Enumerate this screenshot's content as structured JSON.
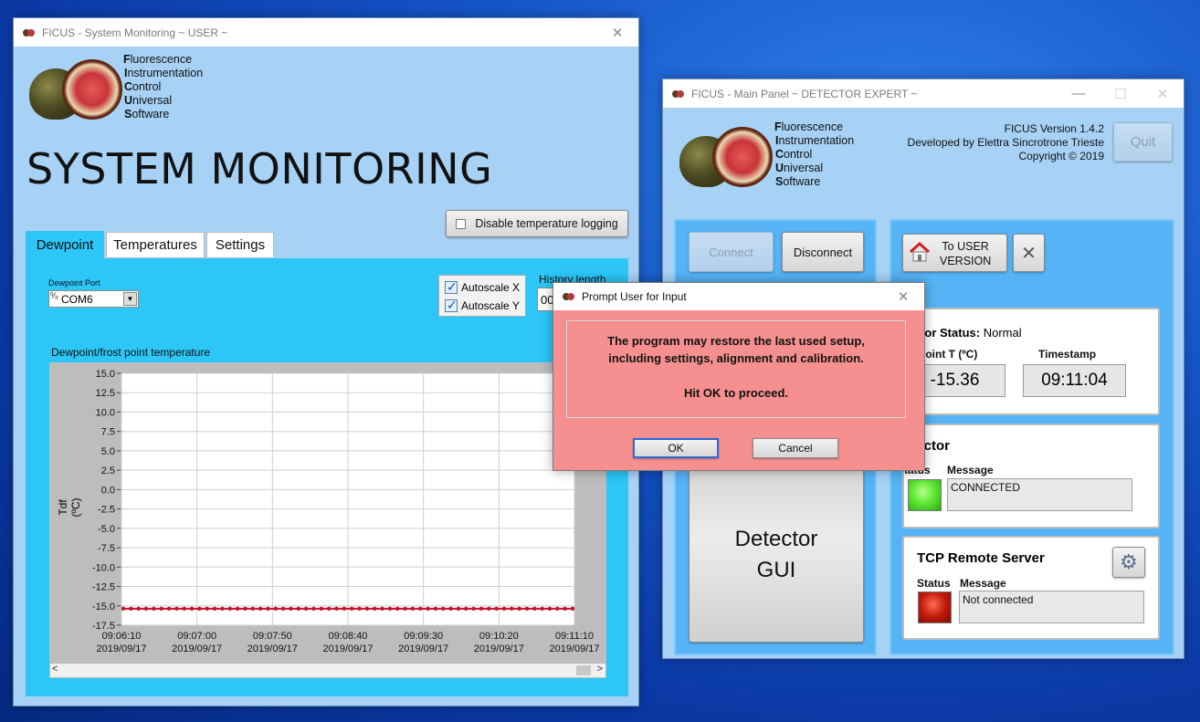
{
  "sysmon": {
    "title": "FICUS - System Monitoring ~ USER ~",
    "acronym": [
      {
        "first": "F",
        "rest": "luorescence"
      },
      {
        "first": "I",
        "rest": "nstrumentation"
      },
      {
        "first": "C",
        "rest": "ontrol"
      },
      {
        "first": "U",
        "rest": "niversal"
      },
      {
        "first": "S",
        "rest": "oftware"
      }
    ],
    "heading": "SYSTEM MONITORING",
    "disable_logging_label": "Disable temperature logging",
    "tabs": [
      "Dewpoint",
      "Temperatures",
      "Settings"
    ],
    "dewpoint_port_label": "Dewpoint Port",
    "dewpoint_port_value": "COM6",
    "autoscale_x": "Autoscale X",
    "autoscale_y": "Autoscale Y",
    "history_length_label": "History length",
    "history_length_value": "00",
    "chart_title": "Dewpoint/frost point temperature"
  },
  "chart_data": {
    "type": "line",
    "title": "Dewpoint/frost point temperature",
    "ylabel": "Tdf (ºC)",
    "xlabel": "",
    "ylim": [
      -17.5,
      15.0
    ],
    "yticks": [
      "15.0",
      "12.5",
      "10.0",
      "7.5",
      "5.0",
      "2.5",
      "0.0",
      "-2.5",
      "-5.0",
      "-7.5",
      "-10.0",
      "-12.5",
      "-15.0",
      "-17.5"
    ],
    "xticks": [
      {
        "time": "09:06:10",
        "date": "2019/09/17"
      },
      {
        "time": "09:07:00",
        "date": "2019/09/17"
      },
      {
        "time": "09:07:50",
        "date": "2019/09/17"
      },
      {
        "time": "09:08:40",
        "date": "2019/09/17"
      },
      {
        "time": "09:09:30",
        "date": "2019/09/17"
      },
      {
        "time": "09:10:20",
        "date": "2019/09/17"
      },
      {
        "time": "09:11:10",
        "date": "2019/09/17"
      }
    ],
    "xlim": [
      "09:06:10",
      "09:11:10"
    ],
    "grid": true,
    "series": [
      {
        "color": "#c8102e",
        "marker": "circle",
        "y_approx": -15.36,
        "points": 60
      }
    ]
  },
  "main": {
    "title": "FICUS - Main Panel ~ DETECTOR EXPERT ~",
    "version": "FICUS Version 1.4.2",
    "developer": "Developed by Elettra Sincrotrone Trieste",
    "copyright": "Copyright © 2019",
    "quit_label": "Quit",
    "connect_label": "Connect",
    "disconnect_label": "Disconnect",
    "to_user_label_1": "To USER",
    "to_user_label_2": "VERSION",
    "sensor_status_label": "ensor Status:",
    "sensor_status_value": "Normal",
    "dewpoint_label": "ewpoint T (ºC)",
    "dewpoint_value": "-15.36",
    "timestamp_label": "Timestamp",
    "timestamp_value": "09:11:04",
    "detector_gui_1": "Detector",
    "detector_gui_2": "GUI",
    "detector_title": "etector",
    "detector_status_label": "tatus",
    "detector_message_label": "Message",
    "detector_message": "CONNECTED",
    "tcp_title": "TCP Remote Server",
    "tcp_status_label": "Status",
    "tcp_message_label": "Message",
    "tcp_message": "Not connected",
    "led_on_color": "#5ee835",
    "led_off_color": "#c21a0c"
  },
  "dialog": {
    "title": "Prompt User for Input",
    "line1": "The program may restore the last used setup,",
    "line2": "including settings, alignment and calibration.",
    "line3": "Hit OK to proceed.",
    "ok_label": "OK",
    "cancel_label": "Cancel"
  }
}
